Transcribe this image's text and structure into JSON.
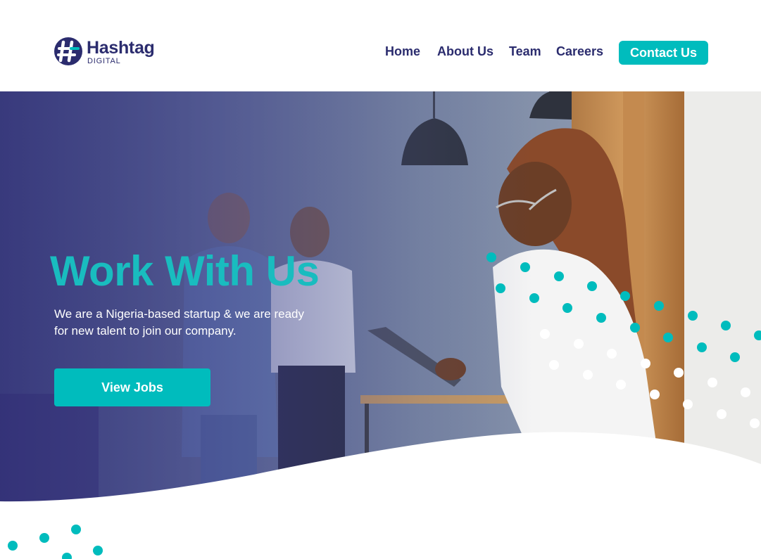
{
  "brand": {
    "name": "Hashtag",
    "sub": "DIGITAL"
  },
  "nav": {
    "items": [
      {
        "label": "Home"
      },
      {
        "label": "About Us"
      },
      {
        "label": "Team"
      },
      {
        "label": "Careers"
      }
    ],
    "contact_label": "Contact Us"
  },
  "hero": {
    "title": "Work With Us",
    "subtitle": "We are a Nigeria-based startup & we are ready for new talent to join our company.",
    "cta_label": "View Jobs"
  },
  "colors": {
    "primary": "#00bcbd",
    "navy": "#2b2c6e",
    "white": "#ffffff"
  },
  "icons": {
    "logo": "hashtag-logo-icon",
    "decoration": "dot-pattern"
  }
}
